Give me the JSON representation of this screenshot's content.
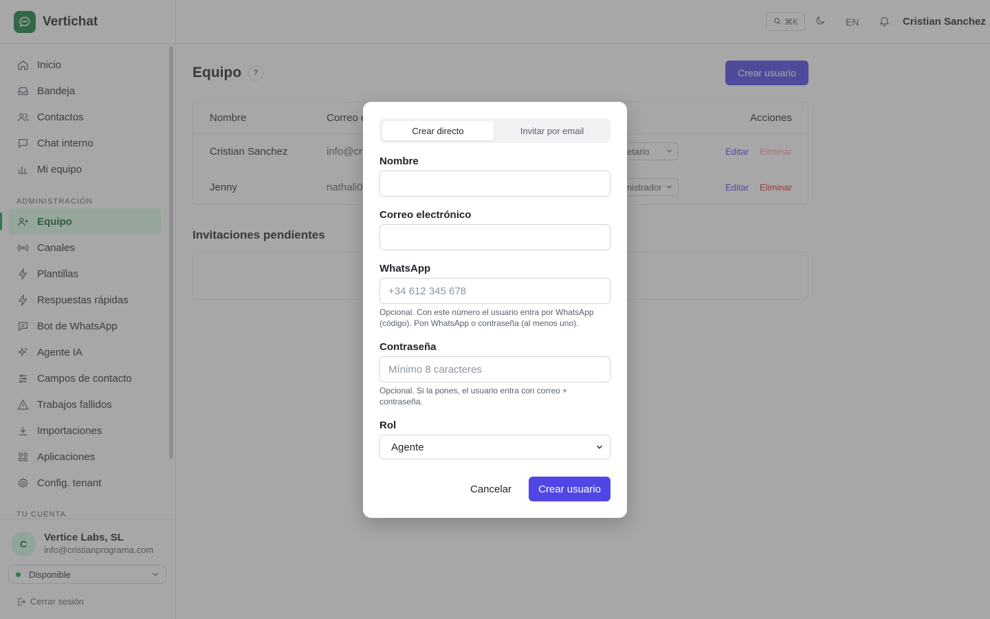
{
  "brand": {
    "name": "Vertichat"
  },
  "sidebar": {
    "items": [
      {
        "label": "Inicio",
        "icon": "home-icon"
      },
      {
        "label": "Bandeja",
        "icon": "inbox-icon"
      },
      {
        "label": "Contactos",
        "icon": "users-icon"
      },
      {
        "label": "Chat interno",
        "icon": "chat-icon"
      },
      {
        "label": "Mi equipo",
        "icon": "bar-chart-icon"
      }
    ],
    "admin_section": "ADMINISTRACIÓN",
    "admin_items": [
      {
        "label": "Equipo",
        "icon": "user-plus-icon",
        "active": true
      },
      {
        "label": "Canales",
        "icon": "broadcast-icon"
      },
      {
        "label": "Plantillas",
        "icon": "bolt-icon"
      },
      {
        "label": "Respuestas rápidas",
        "icon": "bolt-icon"
      },
      {
        "label": "Bot de WhatsApp",
        "icon": "chat-icon"
      },
      {
        "label": "Agente IA",
        "icon": "sparkles-icon"
      },
      {
        "label": "Campos de contacto",
        "icon": "sliders-icon"
      },
      {
        "label": "Trabajos fallidos",
        "icon": "warning-icon"
      },
      {
        "label": "Importaciones",
        "icon": "download-icon"
      },
      {
        "label": "Aplicaciones",
        "icon": "grid-icon"
      },
      {
        "label": "Config. tenant",
        "icon": "gear-icon"
      }
    ],
    "account_section": "TU CUENTA",
    "account": {
      "avatar_initial": "C",
      "name": "Vertice Labs, SL",
      "email": "info@cristianprograma.com",
      "status": "Disponible",
      "logout": "Cerrar sesión"
    }
  },
  "header": {
    "search_shortcut": "⌘K",
    "language": "EN",
    "user_name": "Cristian Sanchez"
  },
  "main": {
    "title": "Equipo",
    "help": "?",
    "create_button": "Crear usuario",
    "table": {
      "headers": {
        "name": "Nombre",
        "email": "Correo e",
        "actions": "Acciones"
      },
      "rows": [
        {
          "name": "Cristian Sanchez",
          "email": "info@cri",
          "role": "etario",
          "edit": "Editar",
          "delete": "Eliminar"
        },
        {
          "name": "Jenny",
          "email": "nathali0",
          "role": "nistrador",
          "edit": "Editar",
          "delete": "Eliminar"
        }
      ]
    },
    "pending_title": "Invitaciones pendientes"
  },
  "modal": {
    "tabs": {
      "direct": "Crear directo",
      "invite": "Invitar por email"
    },
    "name_label": "Nombre",
    "name_value": "",
    "email_label": "Correo electrónico",
    "email_value": "",
    "whatsapp_label": "WhatsApp",
    "whatsapp_placeholder": "+34 612 345 678",
    "whatsapp_hint": "Opcional. Con este número el usuario entra por WhatsApp (código). Pon WhatsApp o contraseña (al menos uno).",
    "password_label": "Contraseña",
    "password_placeholder": "Mínimo 8 caracteres",
    "password_hint": "Opcional. Si la pones, el usuario entra con correo + contraseña.",
    "role_label": "Rol",
    "role_value": "Agente",
    "cancel": "Cancelar",
    "submit": "Crear usuario"
  },
  "colors": {
    "accent": "#4f46e5",
    "brand": "#15803d",
    "active_bg": "#dcfce7",
    "danger": "#dc2626"
  }
}
